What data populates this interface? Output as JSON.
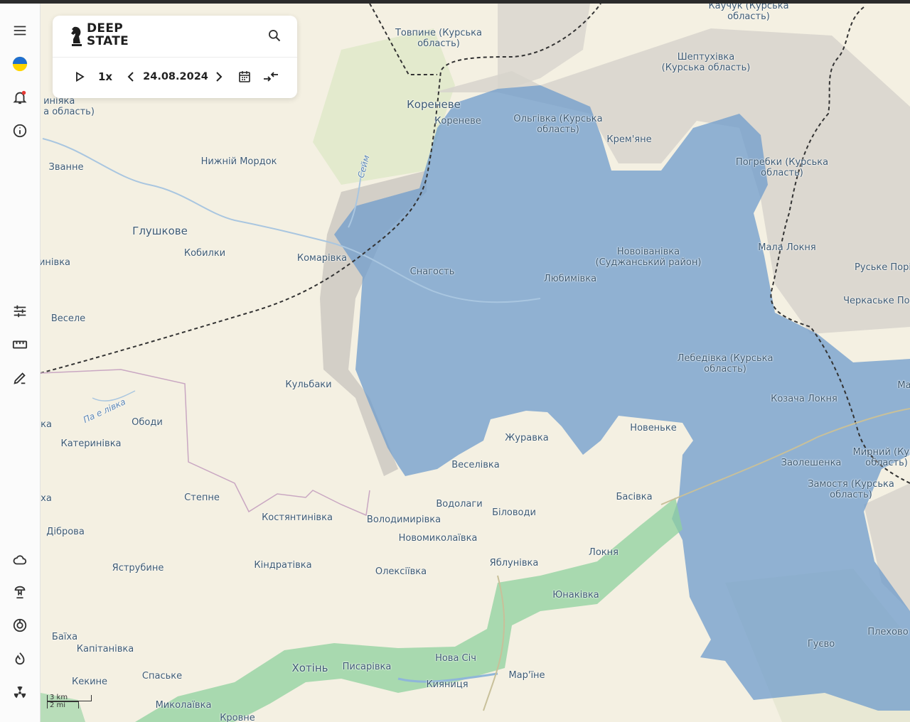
{
  "app": {
    "brand_line1": "DEEP",
    "brand_line2": "STATE"
  },
  "controls": {
    "speed": "1x",
    "date": "24.08.2024"
  },
  "sidebar": {
    "icons": [
      "menu-icon",
      "ukraine-flag-icon",
      "bell-icon",
      "info-icon",
      "sliders-icon",
      "ruler-icon",
      "draw-icon",
      "cloud-icon",
      "mushroom-cloud-icon",
      "target-icon",
      "fire-icon",
      "radiation-icon"
    ]
  },
  "scale": {
    "km": "3 km",
    "mi": "2 mi"
  },
  "colors": {
    "occupied_blue": "#6f9ccc",
    "contested_grey": "#c9c6c0",
    "green_zone": "#8fd19e",
    "land": "#f4f0e2"
  },
  "places": {
    "kauchuk": "Каучук (Курська\nобласть)",
    "tovpyne": "Товпине (Курська\nобласть)",
    "sheptukhivka": "Шептухівка\n(Курська область)",
    "kyrkivka_left": "иніяка\nа область)",
    "korenevo_big": "Кореневе",
    "korenevo": "Кореневе",
    "olhivka": "Ольгівка (Курська\nобласть)",
    "kremyane": "Крем'яне",
    "zvanne": "Званне",
    "nyzhnii_mordok": "Нижній Мордок",
    "seim": "Сейм",
    "pogrebky": "Погребки (Курська\nобласть)",
    "glushkove": "Глушкове",
    "kobylky": "Кобилки",
    "komarivka": "Комарівка",
    "snagost": "Снагость",
    "novoivanivka": "Новоіванівка\n(Суджанський район)",
    "lyubymivka": "Любимівка",
    "mala_lokhnia": "Мала Локня",
    "ruske_pori": "Руське Порі",
    "cherkaske_pori": "Черкаське Пор",
    "ynivka": "инівка",
    "vesele": "Веселе",
    "lebedivka": "Лебедівка (Курська\nобласть)",
    "kulbaky": "Кульбаки",
    "pavlivka_river": "Па е лівка",
    "kozacha_lokhnia": "Козача Локня",
    "ma": "Ма",
    "ka": "ка",
    "obody": "Ободи",
    "katerynivka": "Катеринівка",
    "zhuravka": "Журавка",
    "novenke": "Новеньке",
    "myrnyi": "Мирний (Курс\nобласть)",
    "veselivka": "Веселівка",
    "zaoleshenka": "Заолешенка",
    "zamostia": "Замостя (Курська\nобласть)",
    "kha": "ха",
    "stepne": "Степне",
    "vodolahy": "Водолаги",
    "basivka": "Басівка",
    "kostiantynivka": "Костянтинівка",
    "volodymyrivka": "Володимирівка",
    "bilovody": "Біловоди",
    "dibrova": "Діброва",
    "novomykolaivka": "Новомиколаївка",
    "lokhnia": "Локня",
    "yastrubyne": "Яструбине",
    "kindrativka": "Кіндратівка",
    "yablunivka": "Яблунівка",
    "oleksiivka": "Олексіївка",
    "yunakivka": "Юнаківка",
    "baikha": "Баїха",
    "kapitanivka": "Капітанівка",
    "plekhovo": "Плехово",
    "huevo": "Гуєво",
    "nova_sich": "Нова Січ",
    "khotin": "Хотінь",
    "pysarivka": "Писарівка",
    "spaske": "Спаське",
    "marine": "Мар'їне",
    "kekyne": "Кекине",
    "kyianytsia": "Кияниця",
    "mykolaivka": "Миколаївка",
    "krovne": "Кровне"
  }
}
